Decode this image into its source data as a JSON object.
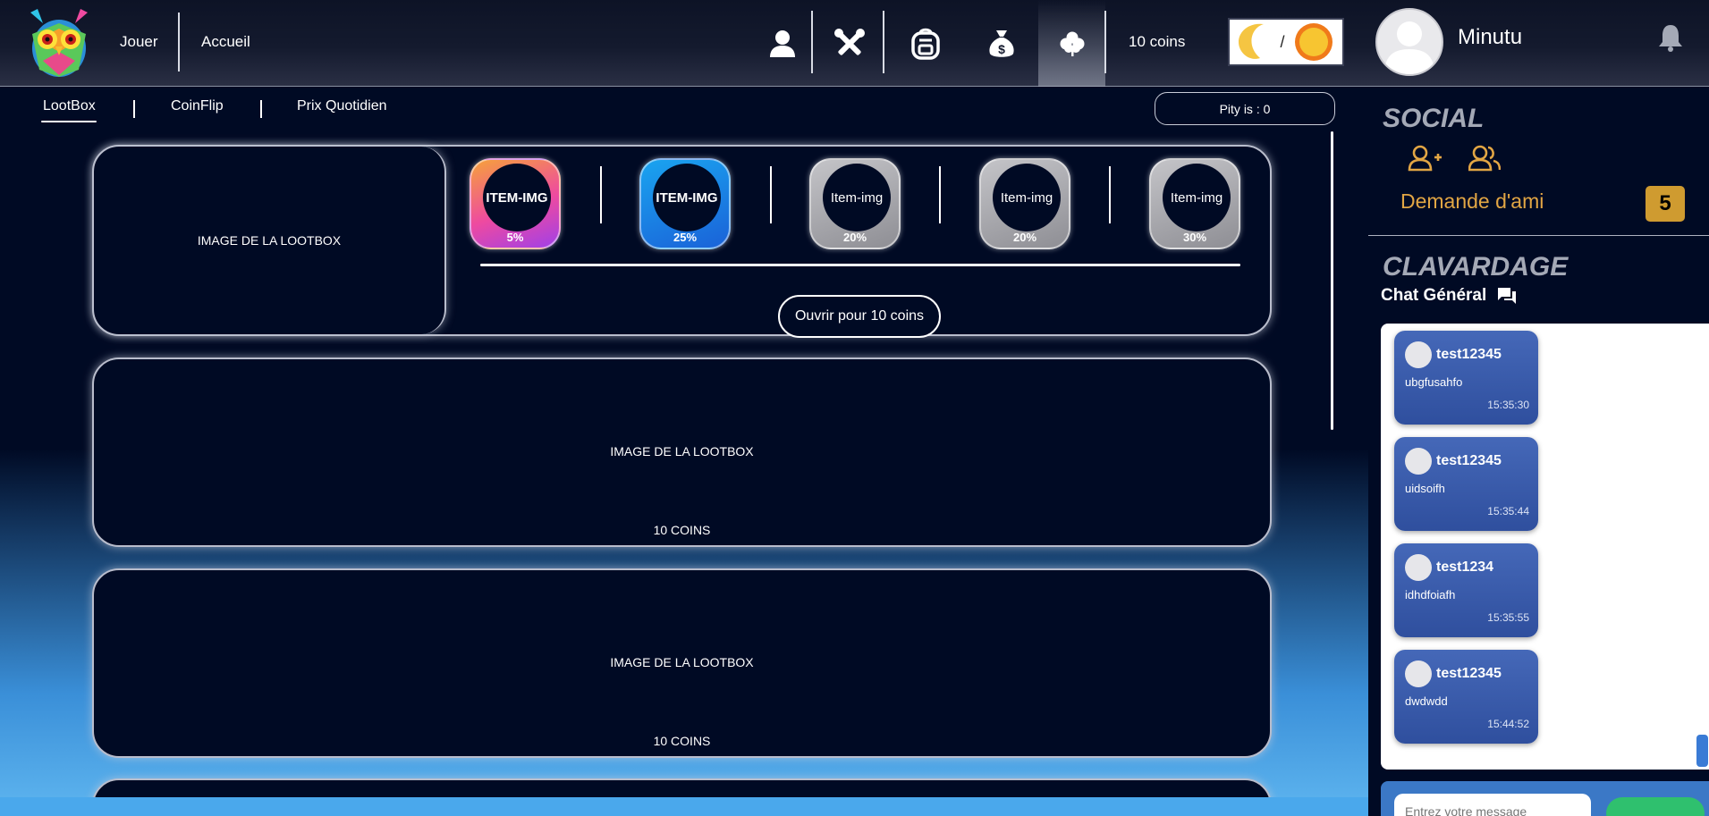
{
  "header": {
    "nav": {
      "play": "Jouer",
      "home": "Accueil"
    },
    "tools": [
      "profile-icon",
      "tools-icon",
      "backpack-icon",
      "money-bag-icon",
      "clover-icon"
    ],
    "coins": "10 coins",
    "theme_separator": "/"
  },
  "user": {
    "name": "Minutu"
  },
  "subnav": {
    "tabs": [
      {
        "label": "LootBox",
        "active": true
      },
      {
        "label": "CoinFlip"
      },
      {
        "label": "Prix Quotidien"
      }
    ],
    "pity": "Pity is : 0"
  },
  "lootboxes": {
    "featured": {
      "image_label": "IMAGE DE LA LOOTBOX",
      "items": [
        {
          "label": "ITEM-IMG",
          "chance": "5%"
        },
        {
          "label": "ITEM-IMG",
          "chance": "25%"
        },
        {
          "label": "Item-img",
          "chance": "20%"
        },
        {
          "label": "Item-img",
          "chance": "20%"
        },
        {
          "label": "Item-img",
          "chance": "30%"
        }
      ],
      "open_label": "Ouvrir pour 10 coins"
    },
    "list": [
      {
        "image_label": "IMAGE DE LA LOOTBOX",
        "price": "10 COINS"
      },
      {
        "image_label": "IMAGE DE LA LOOTBOX",
        "price": "10 COINS"
      }
    ]
  },
  "sidebar": {
    "social_title": "SOCIAL",
    "friend_requests_label": "Demande d'ami",
    "friend_requests_count": "5",
    "chat_title": "CLAVARDAGE",
    "chat_channel": "Chat Général",
    "messages": [
      {
        "user": "test12345",
        "text": "ubgfusahfo",
        "time": "15:35:30"
      },
      {
        "user": "test12345",
        "text": "uidsoifh",
        "time": "15:35:44"
      },
      {
        "user": "test1234",
        "text": "idhdfoiafh",
        "time": "15:35:55"
      },
      {
        "user": "test12345",
        "text": "dwdwdd",
        "time": "15:44:52"
      }
    ],
    "input_placeholder": "Entrez votre message"
  },
  "colors": {
    "background": "#000a24",
    "accent_gold": "#cf9b30",
    "chat_bubble": "#3a5fb0",
    "send_button": "#2fc06e"
  }
}
